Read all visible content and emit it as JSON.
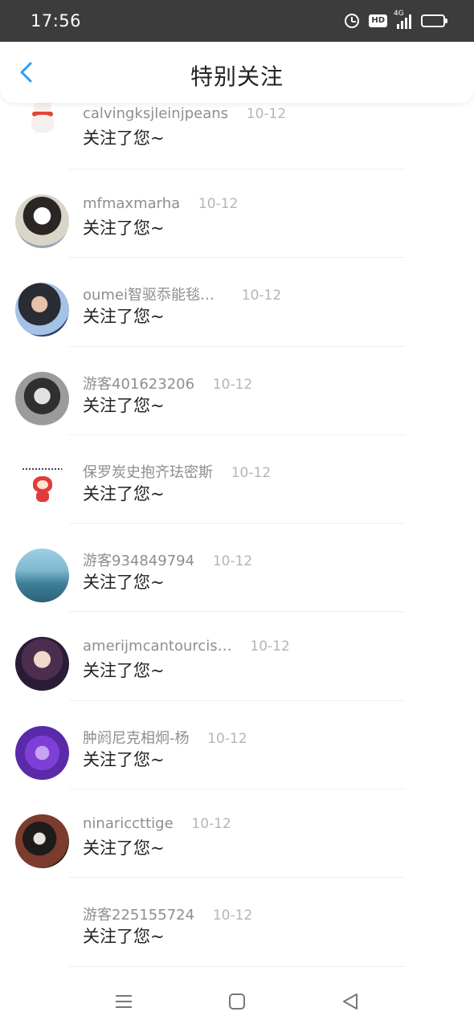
{
  "status_bar": {
    "time": "17:56",
    "hd_label": "HD",
    "network_label": "4G",
    "icons": [
      "alarm-icon",
      "hd-icon",
      "signal-icon",
      "battery-icon"
    ]
  },
  "header": {
    "title": "特别关注",
    "back_icon": "chevron-left-icon",
    "accent_color": "#2a9df4"
  },
  "items": [
    {
      "name": "calvingksjleinjpeans",
      "date": "10-12",
      "message": "关注了您~"
    },
    {
      "name": "mfmaxmarha",
      "date": "10-12",
      "message": "关注了您~"
    },
    {
      "name": "oumei智驱忝能毯…",
      "date": "10-12",
      "message": "关注了您~"
    },
    {
      "name": "游客401623206",
      "date": "10-12",
      "message": "关注了您~"
    },
    {
      "name": "保罗炭史抱齐珐密斯",
      "date": "10-12",
      "message": "关注了您~"
    },
    {
      "name": "游客934849794",
      "date": "10-12",
      "message": "关注了您~"
    },
    {
      "name": "amerijmcantourcis…",
      "date": "10-12",
      "message": "关注了您~"
    },
    {
      "name": "肿阏尼克相炯-杨",
      "date": "10-12",
      "message": "关注了您~"
    },
    {
      "name": "ninariccttige",
      "date": "10-12",
      "message": "关注了您~"
    },
    {
      "name": "游客225155724",
      "date": "10-12",
      "message": "关注了您~"
    }
  ],
  "bottom_nav": {
    "icons": [
      "menu-icon",
      "home-square-icon",
      "back-triangle-icon"
    ]
  }
}
